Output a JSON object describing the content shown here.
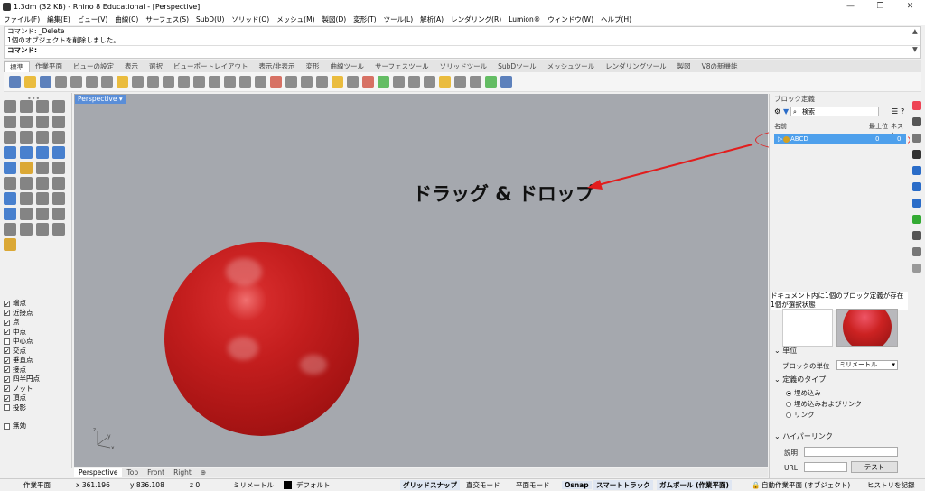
{
  "window": {
    "title": "1.3dm (32 KB) - Rhino 8 Educational - [Perspective]"
  },
  "menu": [
    "ファイル(F)",
    "編集(E)",
    "ビュー(V)",
    "曲線(C)",
    "サーフェス(S)",
    "SubD(U)",
    "ソリッド(O)",
    "メッシュ(M)",
    "製図(D)",
    "変形(T)",
    "ツール(L)",
    "解析(A)",
    "レンダリング(R)",
    "Lumion®",
    "ウィンドウ(W)",
    "ヘルプ(H)"
  ],
  "command": {
    "history": [
      "コマンド: _Delete",
      "1個のオブジェクトを削除しました。"
    ],
    "prompt": "コマンド:"
  },
  "toolbar_tabs": [
    "標準",
    "作業平面",
    "ビューの設定",
    "表示",
    "選択",
    "ビューポートレイアウト",
    "表示/非表示",
    "変形",
    "曲線ツール",
    "サーフェスツール",
    "ソリッドツール",
    "SubDツール",
    "メッシュツール",
    "レンダリングツール",
    "製図",
    "V8の新機能"
  ],
  "osnap": [
    {
      "label": "端点",
      "checked": true
    },
    {
      "label": "近接点",
      "checked": true
    },
    {
      "label": "点",
      "checked": true
    },
    {
      "label": "中点",
      "checked": true
    },
    {
      "label": "中心点",
      "checked": false
    },
    {
      "label": "交点",
      "checked": true
    },
    {
      "label": "垂直点",
      "checked": true
    },
    {
      "label": "接点",
      "checked": true
    },
    {
      "label": "四半円点",
      "checked": true
    },
    {
      "label": "ノット",
      "checked": true
    },
    {
      "label": "頂点",
      "checked": true
    },
    {
      "label": "投影",
      "checked": false
    },
    {
      "label": "無効",
      "checked": false
    }
  ],
  "viewport": {
    "label": "Perspective",
    "annotation": "ドラッグ & ドロップ",
    "axis_x": "x",
    "axis_y": "y",
    "axis_z": "z"
  },
  "viewport_tabs": [
    "Perspective",
    "Top",
    "Front",
    "Right"
  ],
  "block_panel": {
    "title": "ブロック定義",
    "search_placeholder": "検索",
    "col_name": "名前",
    "col_top": "最上位",
    "col_nest": "ネスト",
    "row": {
      "name": "ABCD",
      "top": "0",
      "nest": "0"
    },
    "info_line1": "ドキュメント内に1個のブロック定義が存在",
    "info_line2": "1個が選択状態",
    "sec_units": "単位",
    "units_label": "ブロックの単位",
    "units_value": "ミリメートル",
    "sec_type": "定義のタイプ",
    "type_options": [
      {
        "label": "埋め込み",
        "selected": true
      },
      {
        "label": "埋め込みおよびリンク",
        "selected": false
      },
      {
        "label": "リンク",
        "selected": false
      }
    ],
    "sec_link": "ハイパーリンク",
    "desc_label": "説明",
    "url_label": "URL",
    "test_button": "テスト"
  },
  "status": {
    "cplane": "作業平面",
    "x": "x 361.196",
    "y": "y 836.108",
    "z": "z 0",
    "units": "ミリメートル",
    "layer": "デフォルト",
    "grid_snap": "グリッドスナップ",
    "ortho": "直交モード",
    "planar": "平面モード",
    "osnap": "Osnap",
    "smarttrack": "スマートトラック",
    "gumball": "ガムボール (作業平面)",
    "autocplane": "自動作業平面 (オブジェクト)",
    "history": "ヒストリを記録"
  },
  "colors": {
    "accent": "#4ea0ec",
    "sphere": "#c41e1e",
    "arrow": "#e21d1d",
    "viewport_bg": "#a5a8ae"
  }
}
